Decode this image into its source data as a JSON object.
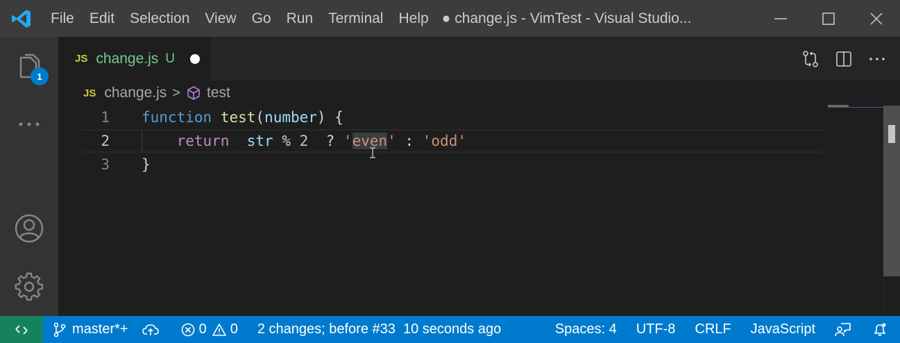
{
  "titlebar": {
    "menu": [
      "File",
      "Edit",
      "Selection",
      "View",
      "Go",
      "Run",
      "Terminal",
      "Help"
    ],
    "window_title": "● change.js - VimTest - Visual Studio..."
  },
  "activitybar": {
    "explorer_badge": "1"
  },
  "tab": {
    "icon_text": "JS",
    "filename": "change.js",
    "status": "U"
  },
  "breadcrumb": {
    "icon_text": "JS",
    "file": "change.js",
    "separator": ">",
    "symbol": "test"
  },
  "editor": {
    "line_numbers": [
      "1",
      "2",
      "3"
    ],
    "line1": {
      "kw": "function",
      "name": "test",
      "open": "(",
      "param": "number",
      "close": ") {"
    },
    "line2": {
      "kw": "return",
      "var": "str",
      "op": "%",
      "num": "2",
      "q": "?",
      "str_open": "'",
      "str_sel": "even",
      "str_close": "'",
      "colon": ":",
      "str2": "'odd'"
    },
    "line3": {
      "text": "}"
    }
  },
  "statusbar": {
    "branch": "master*+",
    "errors": "0",
    "warnings": "0",
    "message": "2 changes; before #33  10 seconds ago",
    "spaces": "Spaces: 4",
    "encoding": "UTF-8",
    "eol": "CRLF",
    "language": "JavaScript"
  },
  "colors": {
    "accent": "#007acc",
    "remote": "#16825d",
    "untracked": "#73c991"
  }
}
